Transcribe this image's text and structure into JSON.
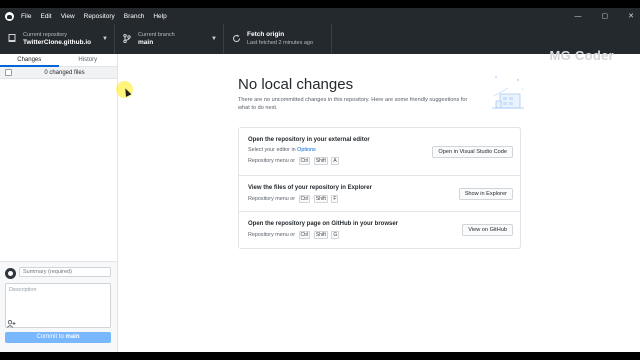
{
  "menu": [
    "File",
    "Edit",
    "View",
    "Repository",
    "Branch",
    "Help"
  ],
  "window_controls": {
    "minimize": "—",
    "maximize": "▢",
    "close": "✕"
  },
  "toolbar": {
    "repo": {
      "label": "Current repository",
      "value": "TwitterClone.github.io"
    },
    "branch": {
      "label": "Current branch",
      "value": "main"
    },
    "fetch": {
      "label": "Fetch origin",
      "value": "Last fetched 2 minutes ago"
    }
  },
  "sidebar": {
    "tabs": [
      "Changes",
      "History"
    ],
    "changed_files": "0 changed files",
    "summary_placeholder": "Summary (required)",
    "description_placeholder": "Description",
    "commit_button": {
      "prefix": "Commit to",
      "branch": "main"
    }
  },
  "main": {
    "watermark": "MG Coder",
    "title": "No local changes",
    "description": "There are no uncommitted changes in this repository. Here are some friendly suggestions for what to do next.",
    "cards": [
      {
        "title": "Open the repository in your external editor",
        "line1_prefix": "Select your editor in",
        "line1_link": "Options",
        "line2": "Repository menu or",
        "keys": [
          "Ctrl",
          "Shift",
          "A"
        ],
        "button": "Open in Visual Studio Code"
      },
      {
        "title": "View the files of your repository in Explorer",
        "line2": "Repository menu or",
        "keys": [
          "Ctrl",
          "Shift",
          "F"
        ],
        "button": "Show in Explorer"
      },
      {
        "title": "Open the repository page on GitHub in your browser",
        "line2": "Repository menu or",
        "keys": [
          "Ctrl",
          "Shift",
          "G"
        ],
        "button": "View on GitHub"
      }
    ]
  },
  "colors": {
    "titlebar": "#24292e",
    "accent": "#0366d6",
    "commit_button": "#79b8ff"
  },
  "icons": [
    "github-logo-icon",
    "repository-icon",
    "branch-icon",
    "sync-icon",
    "caret-down-icon",
    "add-coauthor-icon"
  ]
}
